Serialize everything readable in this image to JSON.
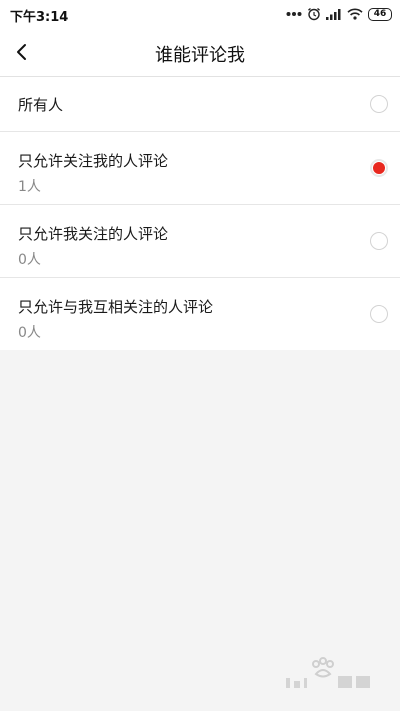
{
  "status_bar": {
    "time": "下午3:14",
    "battery": "46",
    "icons": [
      "more-dots-icon",
      "alarm-icon",
      "signal-icon",
      "wifi-icon",
      "battery-icon"
    ]
  },
  "nav": {
    "title": "谁能评论我",
    "back_icon": "chevron-left-icon"
  },
  "options": [
    {
      "label": "所有人",
      "count": "",
      "selected": false
    },
    {
      "label": "只允许关注我的人评论",
      "count": "1人",
      "selected": true
    },
    {
      "label": "只允许我关注的人评论",
      "count": "0人",
      "selected": false
    },
    {
      "label": "只允许与我互相关注的人评论",
      "count": "0人",
      "selected": false
    }
  ],
  "colors": {
    "accent": "#e8281f",
    "background": "#f4f4f4",
    "surface": "#ffffff"
  }
}
